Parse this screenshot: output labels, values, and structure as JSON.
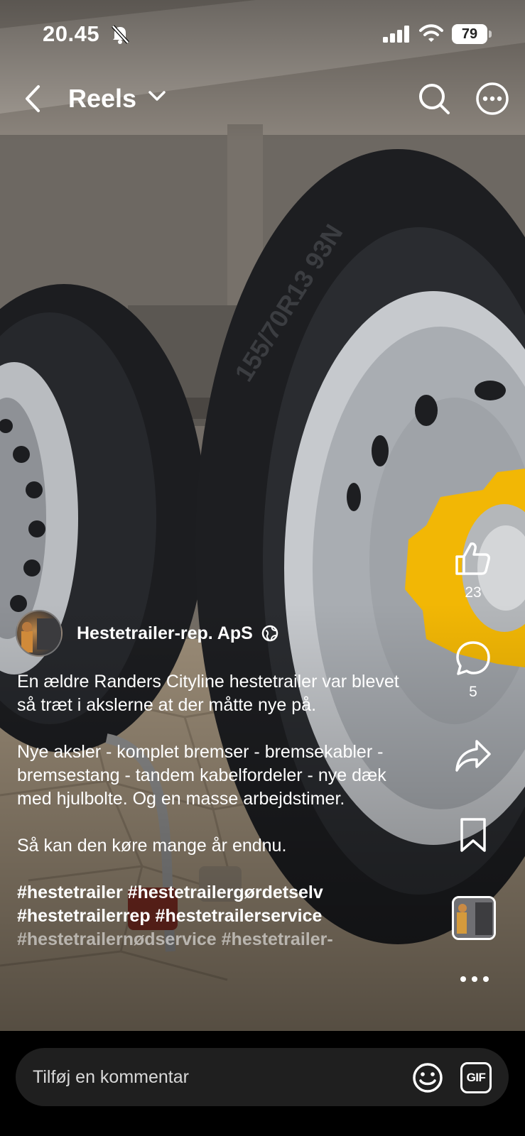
{
  "status_bar": {
    "time": "20.45",
    "battery": "79",
    "icons": [
      "bell-slash-icon",
      "signal-icon",
      "wifi-icon",
      "battery-icon"
    ]
  },
  "topbar": {
    "title": "Reels",
    "icons": [
      "back-chevron-icon",
      "chevron-down-icon",
      "search-icon",
      "more-circle-icon"
    ]
  },
  "rail": {
    "likes": "23",
    "comments": "5",
    "icons": [
      "thumbs-up-icon",
      "comment-icon",
      "share-icon",
      "bookmark-icon",
      "audio-thumbnail",
      "more-dots-icon"
    ]
  },
  "post": {
    "author": "Hestetrailer-rep. ApS",
    "caption_p1": "En ældre Randers Cityline hestetrailer var blevet så træt i akslerne at der måtte nye på.",
    "caption_p2": "Nye aksler - komplet bremser - bremsekabler - bremsestang - tandem kabelfordeler - nye dæk med hjulbolte. Og en masse arbejdstimer.",
    "caption_p3": "Så kan den køre mange år endnu.",
    "hashtags_line1": "#hestetrailer #hestetrailergørdetselv",
    "hashtags_line2": "#hestetrailerrep #hestetrailerservice",
    "hashtags_line3": "#hestetrailernødservice #hestetrailer-"
  },
  "video": {
    "tire_marking": "155/70R13 93N"
  },
  "comment_bar": {
    "placeholder": "Tilføj en kommentar",
    "gif_label": "GIF"
  },
  "colors": {
    "background": "#000000",
    "input": "#1f1f1f",
    "reflector": "#f2b705"
  }
}
